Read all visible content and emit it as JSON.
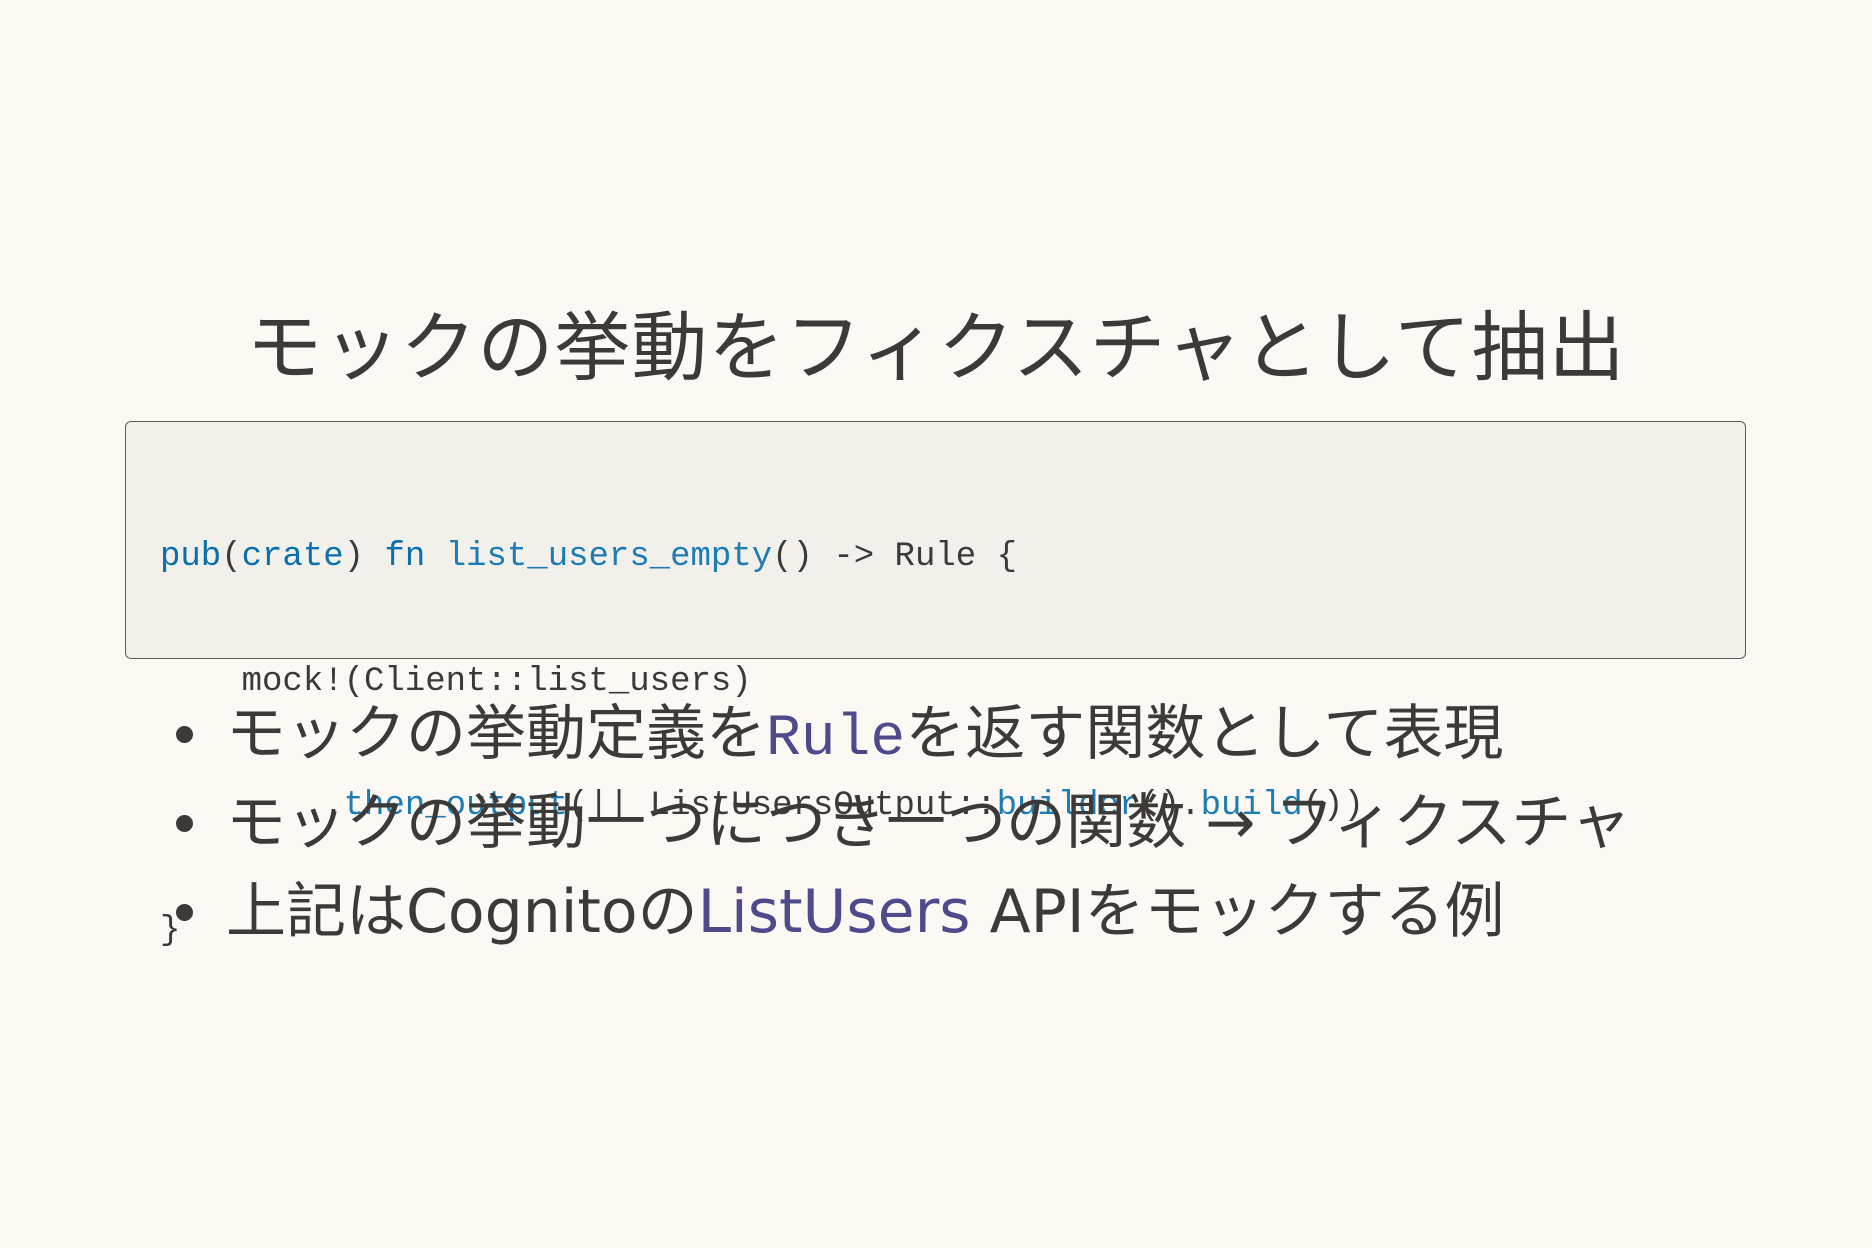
{
  "slide": {
    "title": "モックの挙動をフィクスチャとして抽出",
    "code": {
      "line1": {
        "kw_pub": "pub",
        "p1": "(",
        "kw_crate": "crate",
        "p2": ") ",
        "kw_fn": "fn",
        "p3": " ",
        "fn_name": "list_users_empty",
        "p4": "() -> Rule {"
      },
      "line2": {
        "text": "    mock!(Client::list_users)"
      },
      "line3": {
        "indent": "        .",
        "then_output": "then_output",
        "mid": "(|| ListUsersOutput::",
        "builder": "builder",
        "mid2": "().",
        "build": "build",
        "end": "())"
      },
      "line4": {
        "text": "}"
      }
    },
    "bullets": [
      {
        "before": "モックの挙動定義を",
        "code": "Rule",
        "after": "を返す関数として表現"
      },
      {
        "text": "モックの挙動一つにつき一つの関数 → フィクスチャ"
      },
      {
        "before": "上記はCognitoの",
        "link": "ListUsers",
        "after": " APIをモックする例"
      }
    ],
    "colors": {
      "background": "#fcf9f5",
      "text": "#3b3a39",
      "code_background": "#f2f0ea",
      "code_border": "#5e5b57",
      "keyword": "#0a6fad",
      "inline_code": "#4f4a8c",
      "link": "#4f4a8c"
    }
  }
}
